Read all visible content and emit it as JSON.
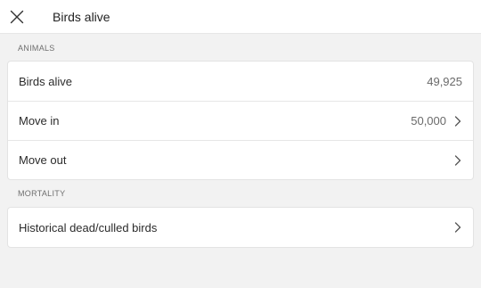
{
  "header": {
    "title": "Birds alive",
    "close_icon": "close-icon"
  },
  "sections": [
    {
      "label": "ANIMALS",
      "rows": [
        {
          "label": "Birds alive",
          "value": "49,925",
          "chevron": false
        },
        {
          "label": "Move in",
          "value": "50,000",
          "chevron": true
        },
        {
          "label": "Move out",
          "value": "",
          "chevron": true
        }
      ]
    },
    {
      "label": "MORTALITY",
      "rows": [
        {
          "label": "Historical dead/culled birds",
          "value": "",
          "chevron": true
        }
      ]
    }
  ],
  "colors": {
    "background": "#f2f2f2",
    "card": "#ffffff",
    "border": "#e3e3e3",
    "text": "#2b2b2b",
    "muted": "#6f6f6f"
  }
}
